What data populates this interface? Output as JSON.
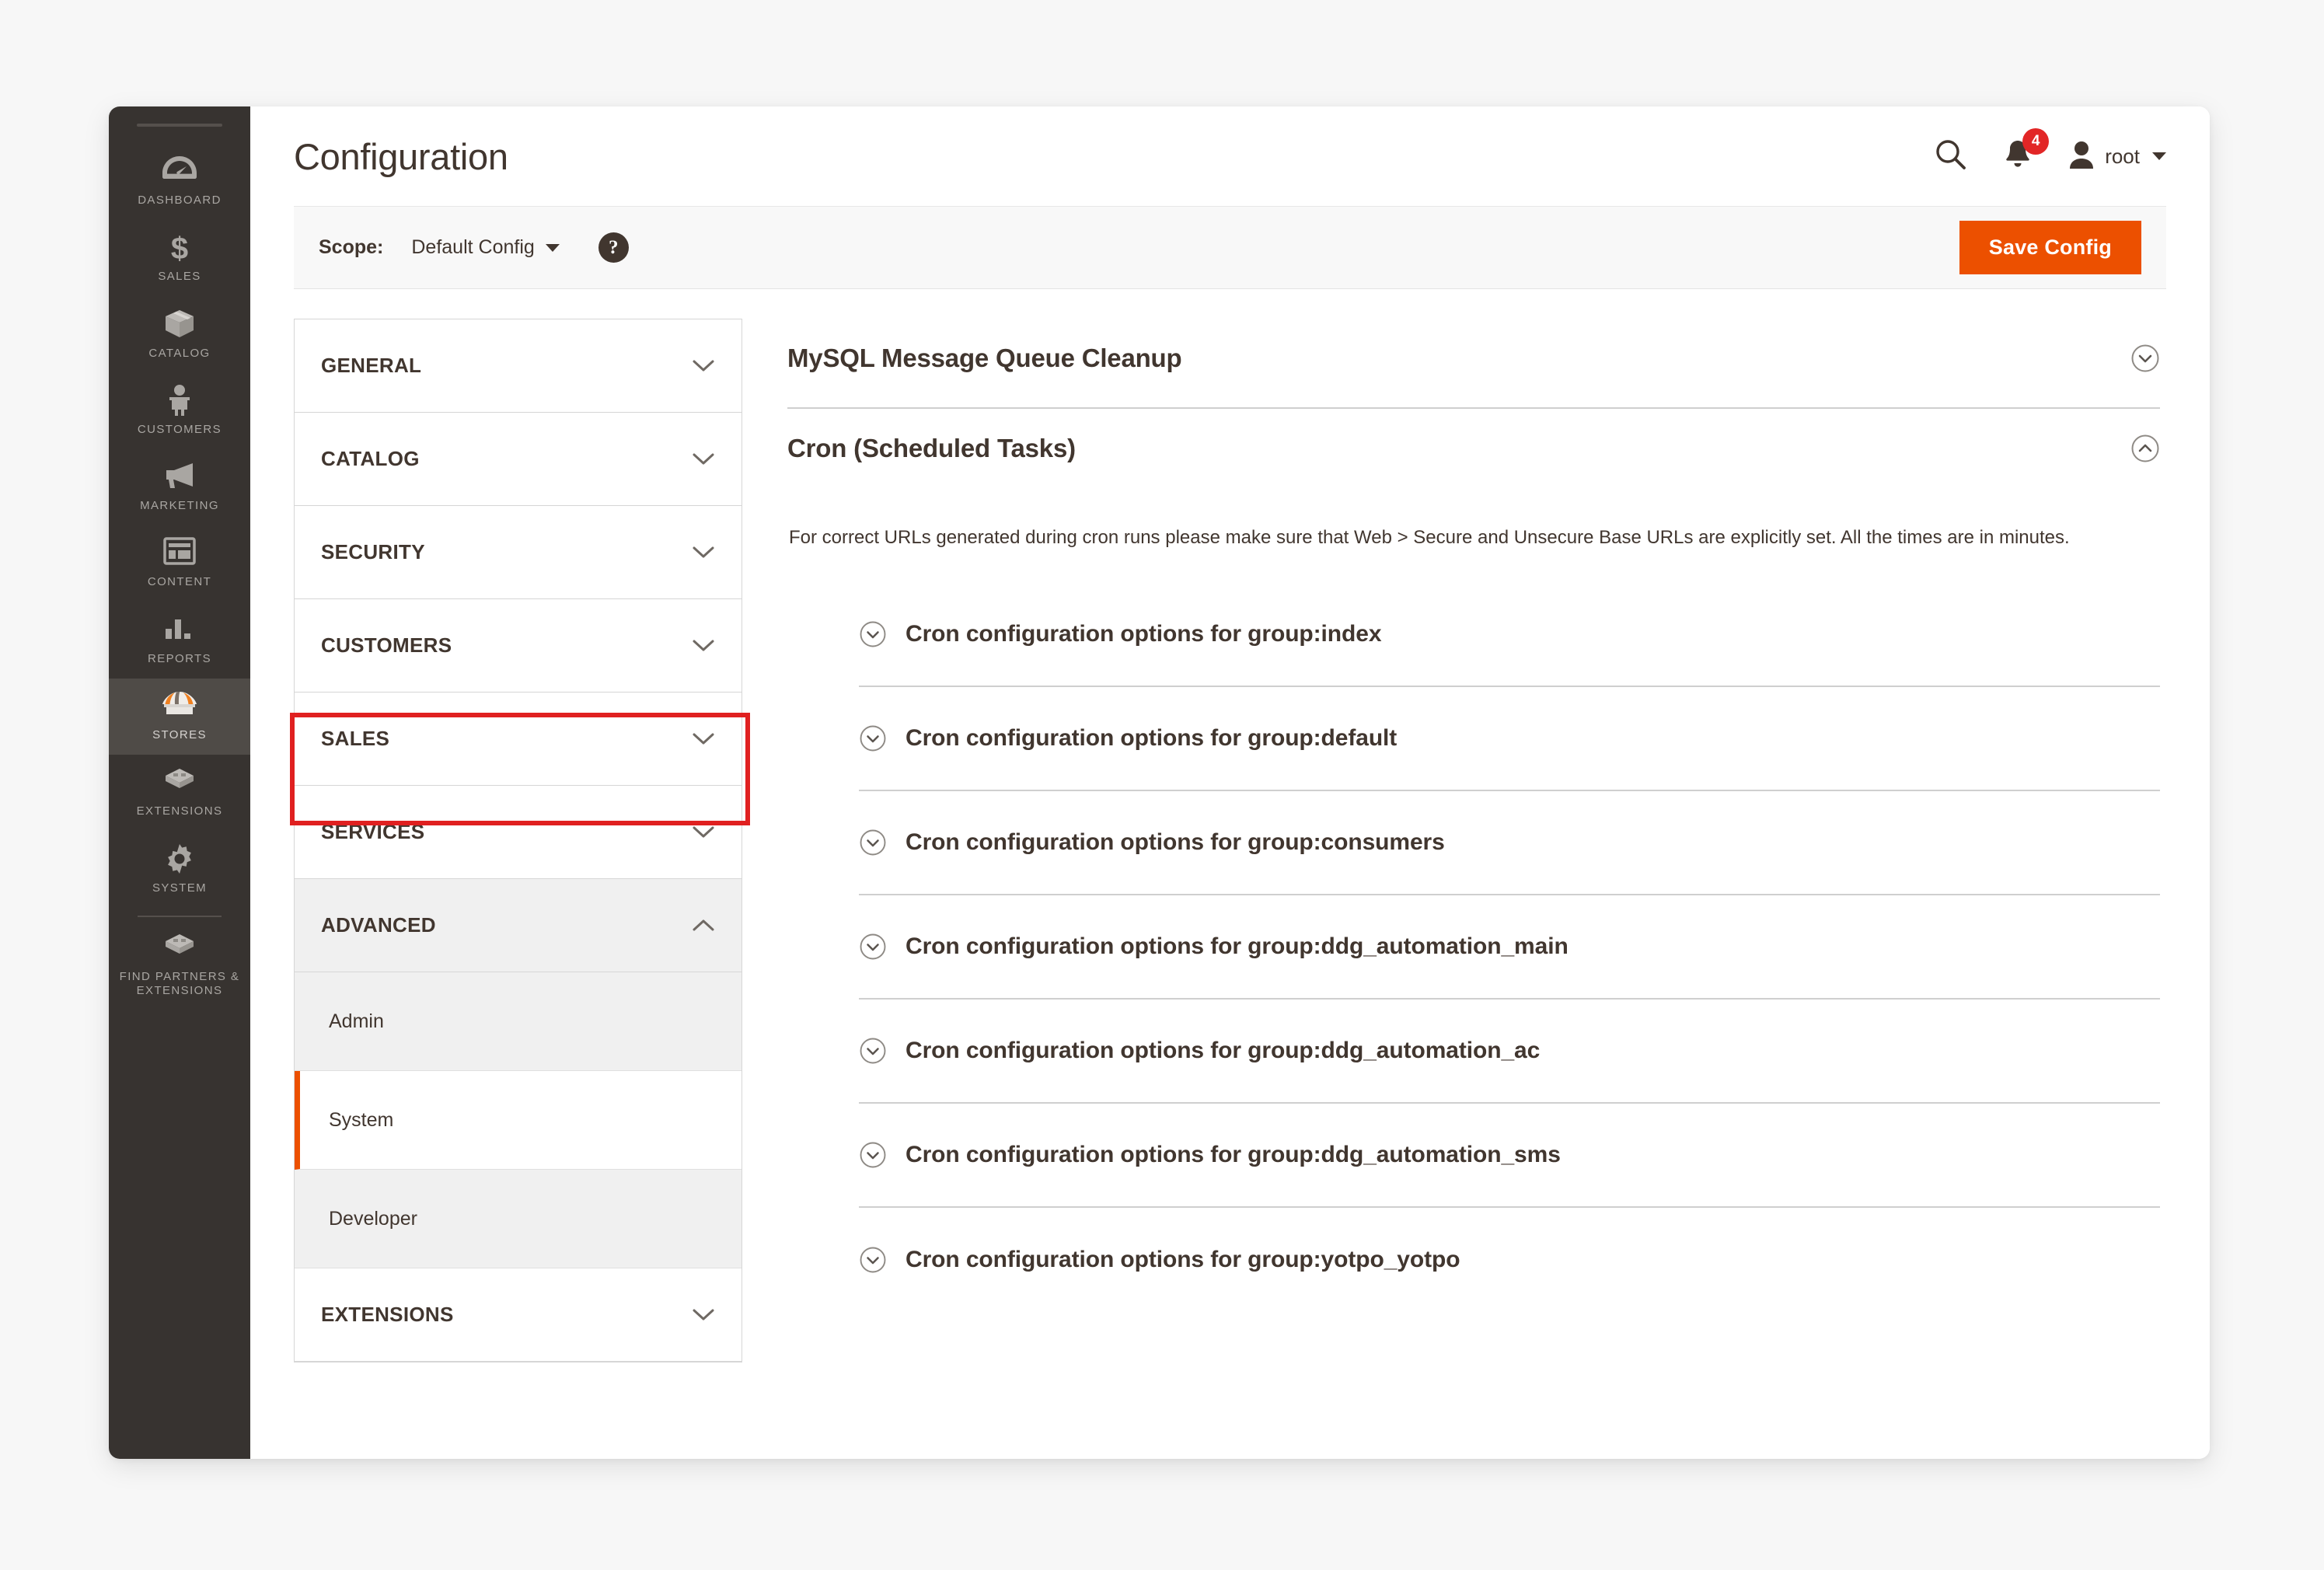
{
  "sidebar": {
    "items": [
      {
        "label": "DASHBOARD",
        "icon": "dashboard-icon",
        "active": false
      },
      {
        "label": "SALES",
        "icon": "dollar-icon",
        "active": false
      },
      {
        "label": "CATALOG",
        "icon": "box-icon",
        "active": false
      },
      {
        "label": "CUSTOMERS",
        "icon": "person-icon",
        "active": false
      },
      {
        "label": "MARKETING",
        "icon": "megaphone-icon",
        "active": false
      },
      {
        "label": "CONTENT",
        "icon": "layout-icon",
        "active": false
      },
      {
        "label": "REPORTS",
        "icon": "bar-chart-icon",
        "active": false
      },
      {
        "label": "STORES",
        "icon": "storefront-icon",
        "active": true
      },
      {
        "label": "EXTENSIONS",
        "icon": "blocks-icon",
        "active": false
      },
      {
        "label": "SYSTEM",
        "icon": "gear-icon",
        "active": false
      },
      {
        "label": "FIND PARTNERS & EXTENSIONS",
        "icon": "blocks-icon",
        "active": false
      }
    ]
  },
  "header": {
    "title": "Configuration",
    "search_icon": "search-icon",
    "notifications_icon": "bell-icon",
    "notifications_count": "4",
    "user_icon": "user-icon",
    "user_name": "root"
  },
  "scope_bar": {
    "label": "Scope:",
    "selected": "Default Config",
    "help_glyph": "?",
    "save_label": "Save Config",
    "accent_color": "#ec5000"
  },
  "config_nav": {
    "sections": [
      {
        "label": "GENERAL",
        "open": false
      },
      {
        "label": "CATALOG",
        "open": false
      },
      {
        "label": "SECURITY",
        "open": false
      },
      {
        "label": "CUSTOMERS",
        "open": false
      },
      {
        "label": "SALES",
        "open": false
      },
      {
        "label": "SERVICES",
        "open": false
      },
      {
        "label": "ADVANCED",
        "open": true
      }
    ],
    "advanced_children": [
      {
        "label": "Admin",
        "current": false
      },
      {
        "label": "System",
        "current": true
      },
      {
        "label": "Developer",
        "current": false
      }
    ],
    "trailing_section": {
      "label": "EXTENSIONS",
      "open": false
    },
    "highlight_color": "#e02020"
  },
  "main": {
    "sections": [
      {
        "title": "MySQL Message Queue Cleanup",
        "expanded": false
      },
      {
        "title": "Cron (Scheduled Tasks)",
        "expanded": true
      }
    ],
    "cron_description": "For correct URLs generated during cron runs please make sure that Web > Secure and Unsecure Base URLs are explicitly set. All the times are in minutes.",
    "cron_groups": [
      {
        "label": "Cron configuration options for group:index"
      },
      {
        "label": "Cron configuration options for group:default"
      },
      {
        "label": "Cron configuration options for group:consumers"
      },
      {
        "label": "Cron configuration options for group:ddg_automation_main"
      },
      {
        "label": "Cron configuration options for group:ddg_automation_ac"
      },
      {
        "label": "Cron configuration options for group:ddg_automation_sms"
      },
      {
        "label": "Cron configuration options for group:yotpo_yotpo"
      }
    ]
  }
}
